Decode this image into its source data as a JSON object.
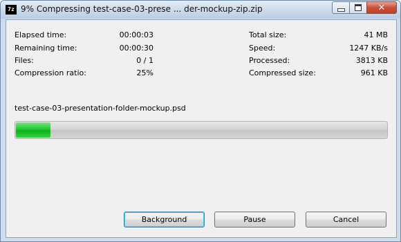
{
  "window": {
    "title": "9% Compressing test-case-03-prese ... der-mockup-zip.zip",
    "app_icon_text": "7z",
    "minimize_label": "Minimize",
    "maximize_label": "Maximize",
    "close_label": "Close"
  },
  "stats_left": [
    {
      "label": "Elapsed time:",
      "value": "00:00:03"
    },
    {
      "label": "Remaining time:",
      "value": "00:00:30"
    },
    {
      "label": "Files:",
      "value": "0 / 1"
    },
    {
      "label": "Compression ratio:",
      "value": "25%"
    }
  ],
  "stats_right": [
    {
      "label": "Total size:",
      "value": "41 MB"
    },
    {
      "label": "Speed:",
      "value": "1247 KB/s"
    },
    {
      "label": "Processed:",
      "value": "3813 KB"
    },
    {
      "label": "Compressed size:",
      "value": "961 KB"
    }
  ],
  "current_file": "test-case-03-presentation-folder-mockup.psd",
  "progress": {
    "percent": 9
  },
  "buttons": {
    "background": "Background",
    "pause": "Pause",
    "cancel": "Cancel"
  },
  "colors": {
    "progress_fill": "#1ccb2c",
    "dialog_background": "#f0f0f0",
    "titlebar": "#cbd9ea"
  }
}
